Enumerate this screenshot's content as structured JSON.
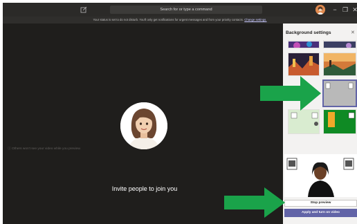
{
  "titlebar": {
    "search_placeholder": "Search for or type a command",
    "icons": [
      "compose-icon",
      "avatar",
      "minimize-icon",
      "maximize-icon",
      "close-icon"
    ],
    "minimize_glyph": "−",
    "maximize_glyph": "❐",
    "close_glyph": "✕"
  },
  "notice": {
    "text": "Your status is set to do not disturb. You'll only get notifications for urgent messages and from your priority contacts.",
    "link": "Change settings."
  },
  "stage": {
    "invite_text": "Invite people to join you"
  },
  "panel": {
    "title": "Background settings",
    "close_glyph": "✕",
    "note": "Others won't see your video while you preview.",
    "stop_preview": "Stop preview",
    "apply": "Apply and turn on video"
  },
  "colors": {
    "accent": "#6264a7",
    "arrow": "#1aa34a",
    "stage_bg": "#1f1e1c",
    "panel_bg": "#f3f2f1"
  }
}
